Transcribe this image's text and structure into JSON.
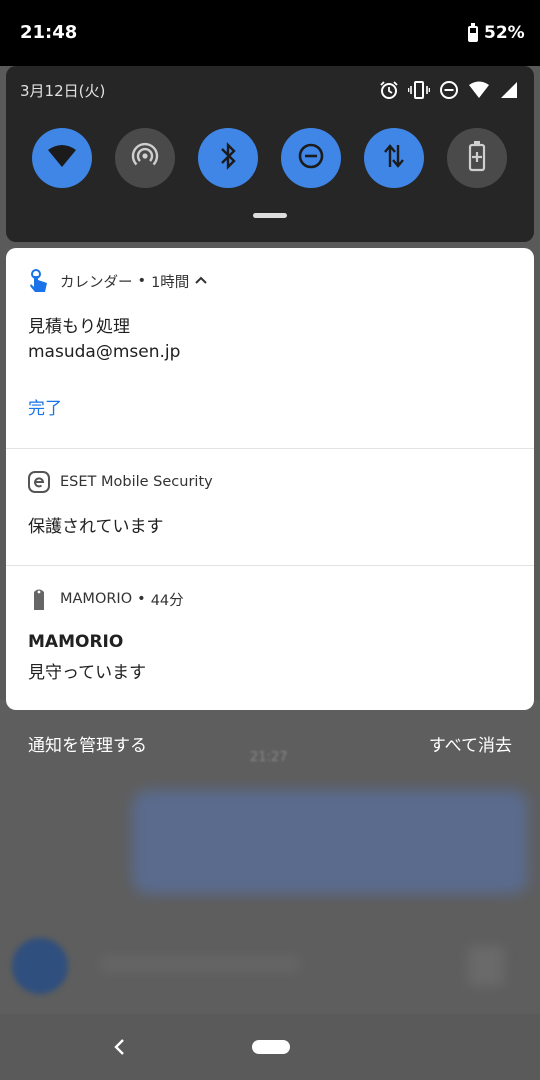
{
  "status_bar": {
    "time": "21:48",
    "battery": "52%"
  },
  "quick_settings": {
    "date": "3月12日(火)",
    "indicators": [
      "alarm-icon",
      "vibrate-icon",
      "dnd-icon",
      "wifi-icon",
      "signal-icon"
    ],
    "tiles": [
      {
        "name": "wifi",
        "icon": "wifi-icon",
        "state": "on"
      },
      {
        "name": "hotspot",
        "icon": "hotspot-icon",
        "state": "off"
      },
      {
        "name": "bluetooth",
        "icon": "bluetooth-icon",
        "state": "on"
      },
      {
        "name": "do-not-disturb",
        "icon": "dnd-icon",
        "state": "on"
      },
      {
        "name": "mobile-data",
        "icon": "data-arrows-icon",
        "state": "on"
      },
      {
        "name": "battery-saver",
        "icon": "battery-saver-icon",
        "state": "off"
      }
    ]
  },
  "notifications": [
    {
      "app": "カレンダー",
      "time": "1時間",
      "title": "見積もり処理",
      "text": "masuda@msen.jp",
      "action": "完了",
      "icon": "calendar-hand-icon"
    },
    {
      "app": "ESET Mobile Security",
      "text": "保護されています",
      "icon": "eset-icon"
    },
    {
      "app": "MAMORIO",
      "time": "44分",
      "title": "MAMORIO",
      "text": "見守っています",
      "icon": "mamorio-tag-icon"
    }
  ],
  "footer": {
    "manage": "通知を管理する",
    "clear_all": "すべて消去"
  },
  "background_app": {
    "time": "21:27"
  },
  "colors": {
    "accent": "#3f86e6",
    "link": "#1a73e8",
    "panel": "#262626"
  }
}
